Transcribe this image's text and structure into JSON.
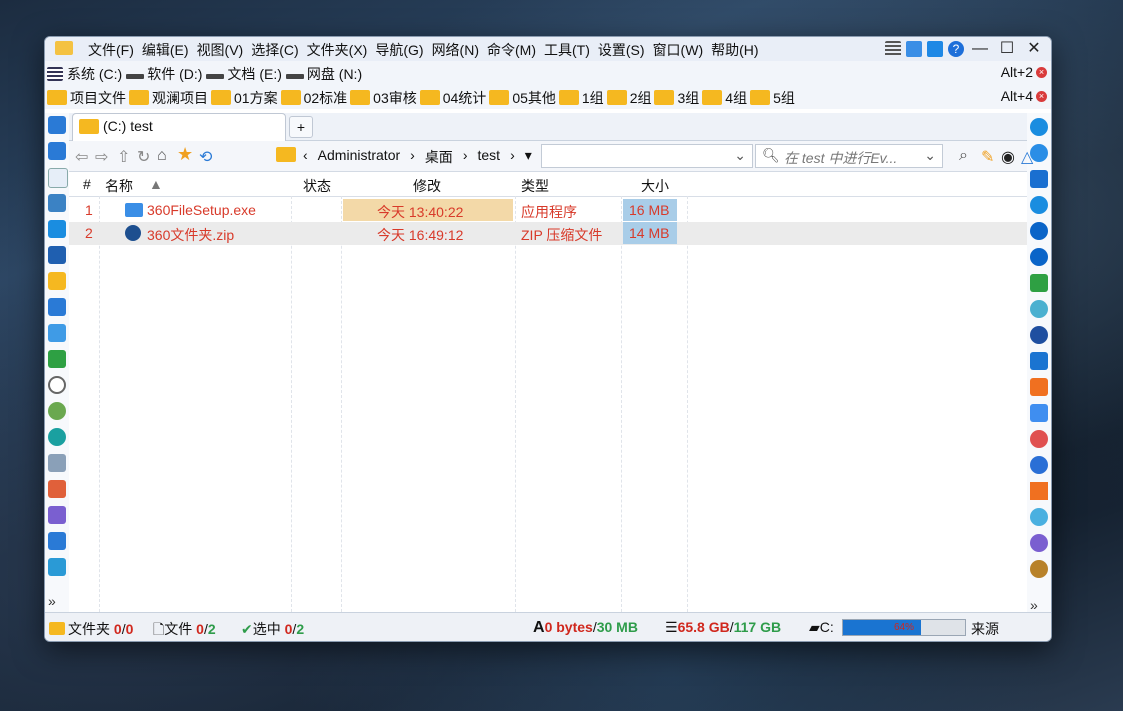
{
  "menubar": {
    "items": [
      "文件(F)",
      "编辑(E)",
      "视图(V)",
      "选择(C)",
      "文件夹(X)",
      "导航(G)",
      "网络(N)",
      "命令(M)",
      "工具(T)",
      "设置(S)",
      "窗口(W)",
      "帮助(H)"
    ]
  },
  "drives": [
    {
      "label": "系统 (C:)"
    },
    {
      "label": "软件 (D:)"
    },
    {
      "label": "文档 (E:)"
    },
    {
      "label": "网盘 (N:)"
    }
  ],
  "drive_hotkey": "Alt+2",
  "favorites": [
    "项目文件",
    "观澜项目",
    "01方案",
    "02标准",
    "03审核",
    "04统计",
    "05其他",
    "1组",
    "2组",
    "3组",
    "4组",
    "5组"
  ],
  "fav_hotkey": "Alt+4",
  "tab": {
    "label": "(C:) test",
    "plus": "+"
  },
  "breadcrumb": [
    "Administrator",
    "桌面",
    "test"
  ],
  "search": {
    "placeholder": "在 test 中进行Ev..."
  },
  "columns": {
    "num": "#",
    "name": "名称",
    "status": "状态",
    "modified": "修改",
    "type": "类型",
    "size": "大小"
  },
  "rows": [
    {
      "num": "1",
      "name": "360FileSetup.exe",
      "modified": "今天 13:40:22",
      "type": "应用程序",
      "size": "16 MB"
    },
    {
      "num": "2",
      "name": "360文件夹.zip",
      "modified": "今天 16:49:12",
      "type": "ZIP 压缩文件",
      "size": "14 MB"
    }
  ],
  "status": {
    "folders_label": "文件夹",
    "folders_sel": "0",
    "folders_total": "0",
    "files_label": "文件",
    "files_sel": "0",
    "files_total": "2",
    "selected_label": "选中",
    "selected_sel": "0",
    "selected_total": "2",
    "sel_bytes": "0 bytes",
    "total_bytes": "30 MB",
    "free": "65.8 GB",
    "capacity": "117 GB",
    "drive": "C:",
    "drive_usage_percent": 64,
    "drive_usage_text": "64%",
    "source": "来源"
  },
  "more": "»",
  "colors": {
    "accent": "#1a74d1",
    "folder": "#f5b820",
    "text_red": "#d83a2a"
  }
}
